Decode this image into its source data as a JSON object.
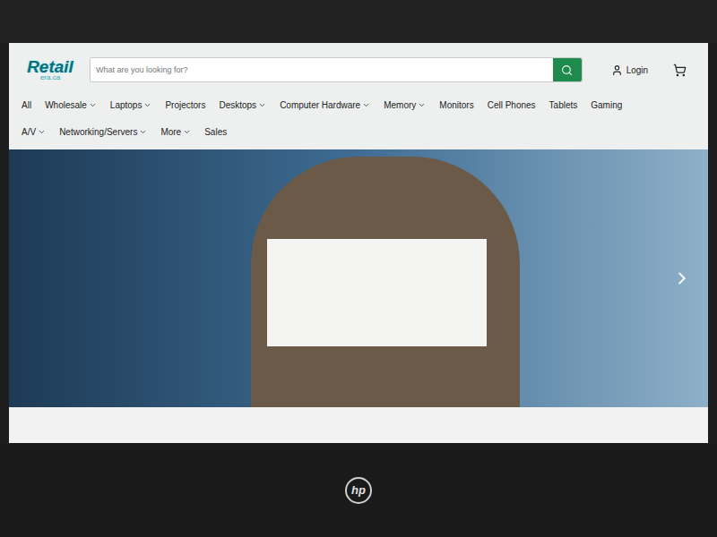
{
  "device": {
    "brand": "hp"
  },
  "header": {
    "logo": {
      "name": "Retail",
      "domain": "era.ca"
    },
    "search": {
      "placeholder": "What are you looking for?"
    },
    "login": "Login"
  },
  "nav": [
    {
      "label": "All",
      "dropdown": false
    },
    {
      "label": "Wholesale",
      "dropdown": true
    },
    {
      "label": "Laptops",
      "dropdown": true
    },
    {
      "label": "Projectors",
      "dropdown": false
    },
    {
      "label": "Desktops",
      "dropdown": true
    },
    {
      "label": "Computer Hardware",
      "dropdown": true
    },
    {
      "label": "Memory",
      "dropdown": true
    },
    {
      "label": "Monitors",
      "dropdown": false
    },
    {
      "label": "Cell Phones",
      "dropdown": false
    },
    {
      "label": "Tablets",
      "dropdown": false
    },
    {
      "label": "Gaming",
      "dropdown": false
    },
    {
      "label": "A/V",
      "dropdown": true
    },
    {
      "label": "Networking/Servers",
      "dropdown": true
    },
    {
      "label": "More",
      "dropdown": true
    },
    {
      "label": "Sales",
      "dropdown": false
    }
  ]
}
